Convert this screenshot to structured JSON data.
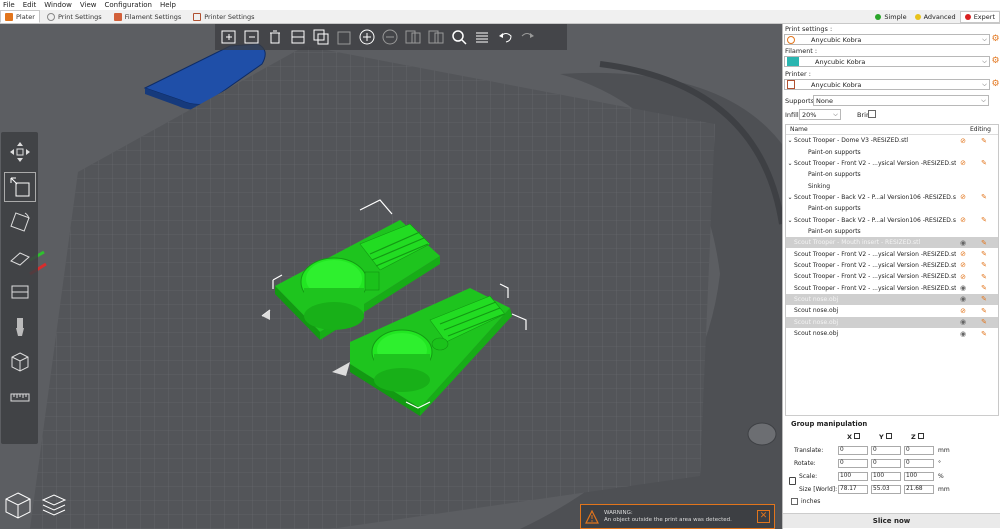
{
  "menu": [
    "File",
    "Edit",
    "Window",
    "View",
    "Configuration",
    "Help"
  ],
  "tabs": [
    {
      "label": "Plater",
      "icon": "plater-icon",
      "active": true
    },
    {
      "label": "Print Settings",
      "icon": "print-settings-icon",
      "active": false
    },
    {
      "label": "Filament Settings",
      "icon": "filament-settings-icon",
      "active": false
    },
    {
      "label": "Printer Settings",
      "icon": "printer-settings-icon",
      "active": false
    }
  ],
  "modes": [
    {
      "label": "Simple",
      "color": "#2aa52a",
      "active": false
    },
    {
      "label": "Advanced",
      "color": "#e8c21a",
      "active": false
    },
    {
      "label": "Expert",
      "color": "#d92121",
      "active": true
    }
  ],
  "panel": {
    "print_settings_label": "Print settings :",
    "print_settings_value": "Anycubic Kobra",
    "filament_label": "Filament :",
    "filament_value": "Anycubic Kobra",
    "filament_color": "#2ab5b0",
    "printer_label": "Printer :",
    "printer_value": "Anycubic Kobra",
    "supports_label": "Supports:",
    "supports_value": "None",
    "infill_label": "Infill:",
    "infill_value": "20%",
    "brim_label": "Brim:"
  },
  "object_list": {
    "header_name": "Name",
    "header_editing": "Editing",
    "rows": [
      {
        "name": "Scout Trooper - Dome V3 -RESIZED.stl",
        "arrow": "v",
        "eye": "hidden",
        "sub": false,
        "selected": false
      },
      {
        "name": "Paint-on supports",
        "arrow": "",
        "eye": "",
        "sub": true,
        "selected": false
      },
      {
        "name": "Scout Trooper - Front V2 - ...ysical Version -RESIZED.stl",
        "arrow": "v",
        "eye": "hidden",
        "sub": false,
        "selected": false
      },
      {
        "name": "Paint-on supports",
        "arrow": "",
        "eye": "",
        "sub": true,
        "selected": false
      },
      {
        "name": "Sinking",
        "arrow": "",
        "eye": "",
        "sub": true,
        "selected": false
      },
      {
        "name": "Scout Trooper - Back V2 - P...al Version106 -RESIZED.stl",
        "arrow": "v",
        "eye": "hidden",
        "sub": false,
        "selected": false
      },
      {
        "name": "Paint-on supports",
        "arrow": "",
        "eye": "",
        "sub": true,
        "selected": false
      },
      {
        "name": "Scout Trooper - Back V2 - P...al Version106 -RESIZED.stl",
        "arrow": "v",
        "eye": "hidden",
        "sub": false,
        "selected": false
      },
      {
        "name": "Paint-on supports",
        "arrow": "",
        "eye": "",
        "sub": true,
        "selected": false
      },
      {
        "name": "Scout Trooper - Mouth insert - RESIZED.stl",
        "arrow": "",
        "eye": "visible",
        "sub": false,
        "selected": true
      },
      {
        "name": "Scout Trooper - Front V2 - ...ysical Version -RESIZED.stl",
        "arrow": "",
        "eye": "hidden",
        "sub": false,
        "selected": false
      },
      {
        "name": "Scout Trooper - Front V2 - ...ysical Version -RESIZED.stl",
        "arrow": "",
        "eye": "hidden",
        "sub": false,
        "selected": false
      },
      {
        "name": "Scout Trooper - Front V2 - ...ysical Version -RESIZED.stl",
        "arrow": "",
        "eye": "hidden",
        "sub": false,
        "selected": false
      },
      {
        "name": "Scout Trooper - Front V2 - ...ysical Version -RESIZED.stl",
        "arrow": "",
        "eye": "visible",
        "sub": false,
        "selected": false
      },
      {
        "name": "Scout nose.obj",
        "arrow": "",
        "eye": "visible",
        "sub": false,
        "selected": true
      },
      {
        "name": "Scout nose.obj",
        "arrow": "",
        "eye": "hidden",
        "sub": false,
        "selected": false
      },
      {
        "name": "Scout nose.obj",
        "arrow": "",
        "eye": "visible",
        "sub": false,
        "selected": true
      },
      {
        "name": "Scout nose.obj",
        "arrow": "",
        "eye": "visible",
        "sub": false,
        "selected": false
      }
    ]
  },
  "group_manipulation": {
    "title": "Group manipulation",
    "axis_x": "X",
    "axis_y": "Y",
    "axis_z": "Z",
    "translate_label": "Translate:",
    "translate": [
      "0",
      "0",
      "0"
    ],
    "translate_unit": "mm",
    "rotate_label": "Rotate:",
    "rotate": [
      "0",
      "0",
      "0"
    ],
    "rotate_unit": "°",
    "scale_label": "Scale:",
    "scale": [
      "100",
      "100",
      "100"
    ],
    "scale_unit": "%",
    "size_label": "Size [World]:",
    "size": [
      "78.17",
      "55.03",
      "21.68"
    ],
    "size_unit": "mm",
    "inches_label": "inches"
  },
  "slice_button": "Slice now",
  "warning": {
    "title": "WARNING:",
    "message": "An object outside the print area was detected."
  },
  "colors": {
    "accent": "#e2751c",
    "model_green": "#22e622",
    "bed_grid": "#707276",
    "background": "#5a5c60"
  }
}
